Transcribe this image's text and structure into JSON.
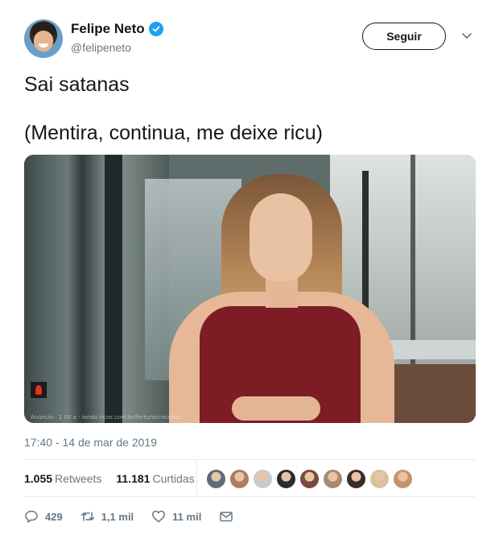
{
  "user": {
    "name": "Felipe Neto",
    "handle": "@felipeneto",
    "verified_icon": "verified-badge-icon",
    "avatar_icon": "avatar"
  },
  "header": {
    "follow_label": "Seguir",
    "menu_icon": "chevron-down-icon"
  },
  "tweet": {
    "line1": "Sai satanas",
    "line2": "(Mentira, continua, me deixe ricu)",
    "media_caption": "Anúncio · 1 00 a · lendo ricos.com.br/fortunes-ocultas"
  },
  "timestamp": "17:40 - 14 de mar de 2019",
  "stats": {
    "retweets_count": "1.055",
    "retweets_label": "Retweets",
    "likes_count": "11.181",
    "likes_label": "Curtidas"
  },
  "likers": [
    "#5d6b7a",
    "#b07a60",
    "#c7ccd1",
    "#2c2c2c",
    "#7a4a3a",
    "#a88a6e",
    "#3a2d2a",
    "#d8c29a",
    "#c4956b"
  ],
  "actions": {
    "reply_count": "429",
    "retweet_count": "1,1 mil",
    "like_count": "11 mil",
    "reply_icon": "reply-icon",
    "retweet_icon": "retweet-icon",
    "like_icon": "heart-icon",
    "dm_icon": "envelope-icon"
  },
  "colors": {
    "text": "#14171a",
    "muted": "#657786",
    "accent": "#1da1f2",
    "divider": "#e6ecf0"
  }
}
